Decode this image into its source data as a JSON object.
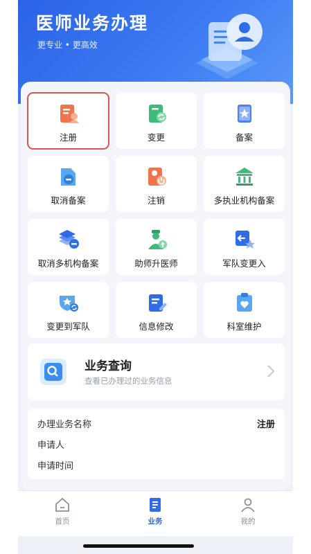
{
  "banner": {
    "title": "医师业务办理",
    "subtitle": "更专业 • 更高效"
  },
  "services": [
    {
      "label": "注册",
      "icon": "register-icon",
      "selected": true
    },
    {
      "label": "变更",
      "icon": "change-icon"
    },
    {
      "label": "备案",
      "icon": "filing-icon"
    },
    {
      "label": "取消备案",
      "icon": "cancel-filing-icon"
    },
    {
      "label": "注销",
      "icon": "deregister-icon"
    },
    {
      "label": "多执业机构备案",
      "icon": "multi-institution-icon"
    },
    {
      "label": "取消多机构备案",
      "icon": "cancel-multi-institution-icon"
    },
    {
      "label": "助师升医师",
      "icon": "assistant-upgrade-icon"
    },
    {
      "label": "军队变更入",
      "icon": "military-transfer-in-icon"
    },
    {
      "label": "变更到军队",
      "icon": "transfer-to-military-icon"
    },
    {
      "label": "信息修改",
      "icon": "edit-info-icon"
    },
    {
      "label": "科室维护",
      "icon": "department-icon"
    }
  ],
  "query": {
    "title": "业务查询",
    "subtitle": "查看已办理过的业务信息"
  },
  "info": {
    "name_label": "办理业务名称",
    "name_value": "注册",
    "applicant_label": "申请人",
    "time_label": "申请时间"
  },
  "nav": {
    "home": "首页",
    "business": "业务",
    "mine": "我的",
    "active": "business"
  },
  "colors": {
    "accent": "#2f6ce8",
    "selected_border": "#d9534f"
  }
}
